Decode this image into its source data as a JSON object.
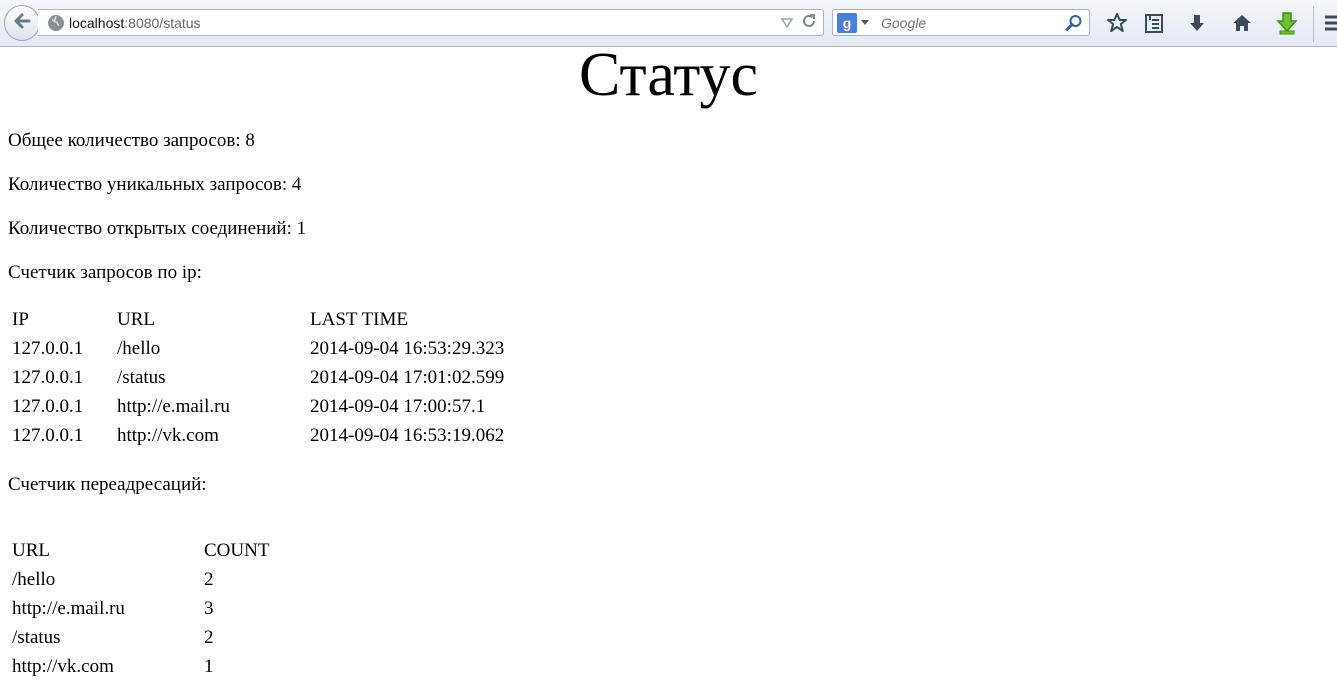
{
  "browser": {
    "url_host": "localhost",
    "url_rest": ":8080/status",
    "search_placeholder": "Google"
  },
  "page": {
    "title": "Статус",
    "total_requests": "Общее количество запросов: 8",
    "unique_requests": "Количество уникальных запросов: 4",
    "open_connections": "Количество открытых соединений: 1",
    "ip_counter_heading": "Счетчик запросов по ip:",
    "redirect_counter_heading": "Счетчик переадресаций:"
  },
  "ip_table": {
    "headers": [
      "IP",
      "URL",
      "LAST TIME"
    ],
    "rows": [
      [
        "127.0.0.1",
        "/hello",
        "2014-09-04 16:53:29.323"
      ],
      [
        "127.0.0.1",
        "/status",
        "2014-09-04 17:01:02.599"
      ],
      [
        "127.0.0.1",
        "http://e.mail.ru",
        "2014-09-04 17:00:57.1"
      ],
      [
        "127.0.0.1",
        "http://vk.com",
        "2014-09-04 16:53:19.062"
      ]
    ]
  },
  "redirect_table": {
    "headers": [
      "URL",
      "COUNT"
    ],
    "rows": [
      [
        "/hello",
        "2"
      ],
      [
        "http://e.mail.ru",
        "3"
      ],
      [
        "/status",
        "2"
      ],
      [
        "http://vk.com",
        "1"
      ]
    ]
  }
}
